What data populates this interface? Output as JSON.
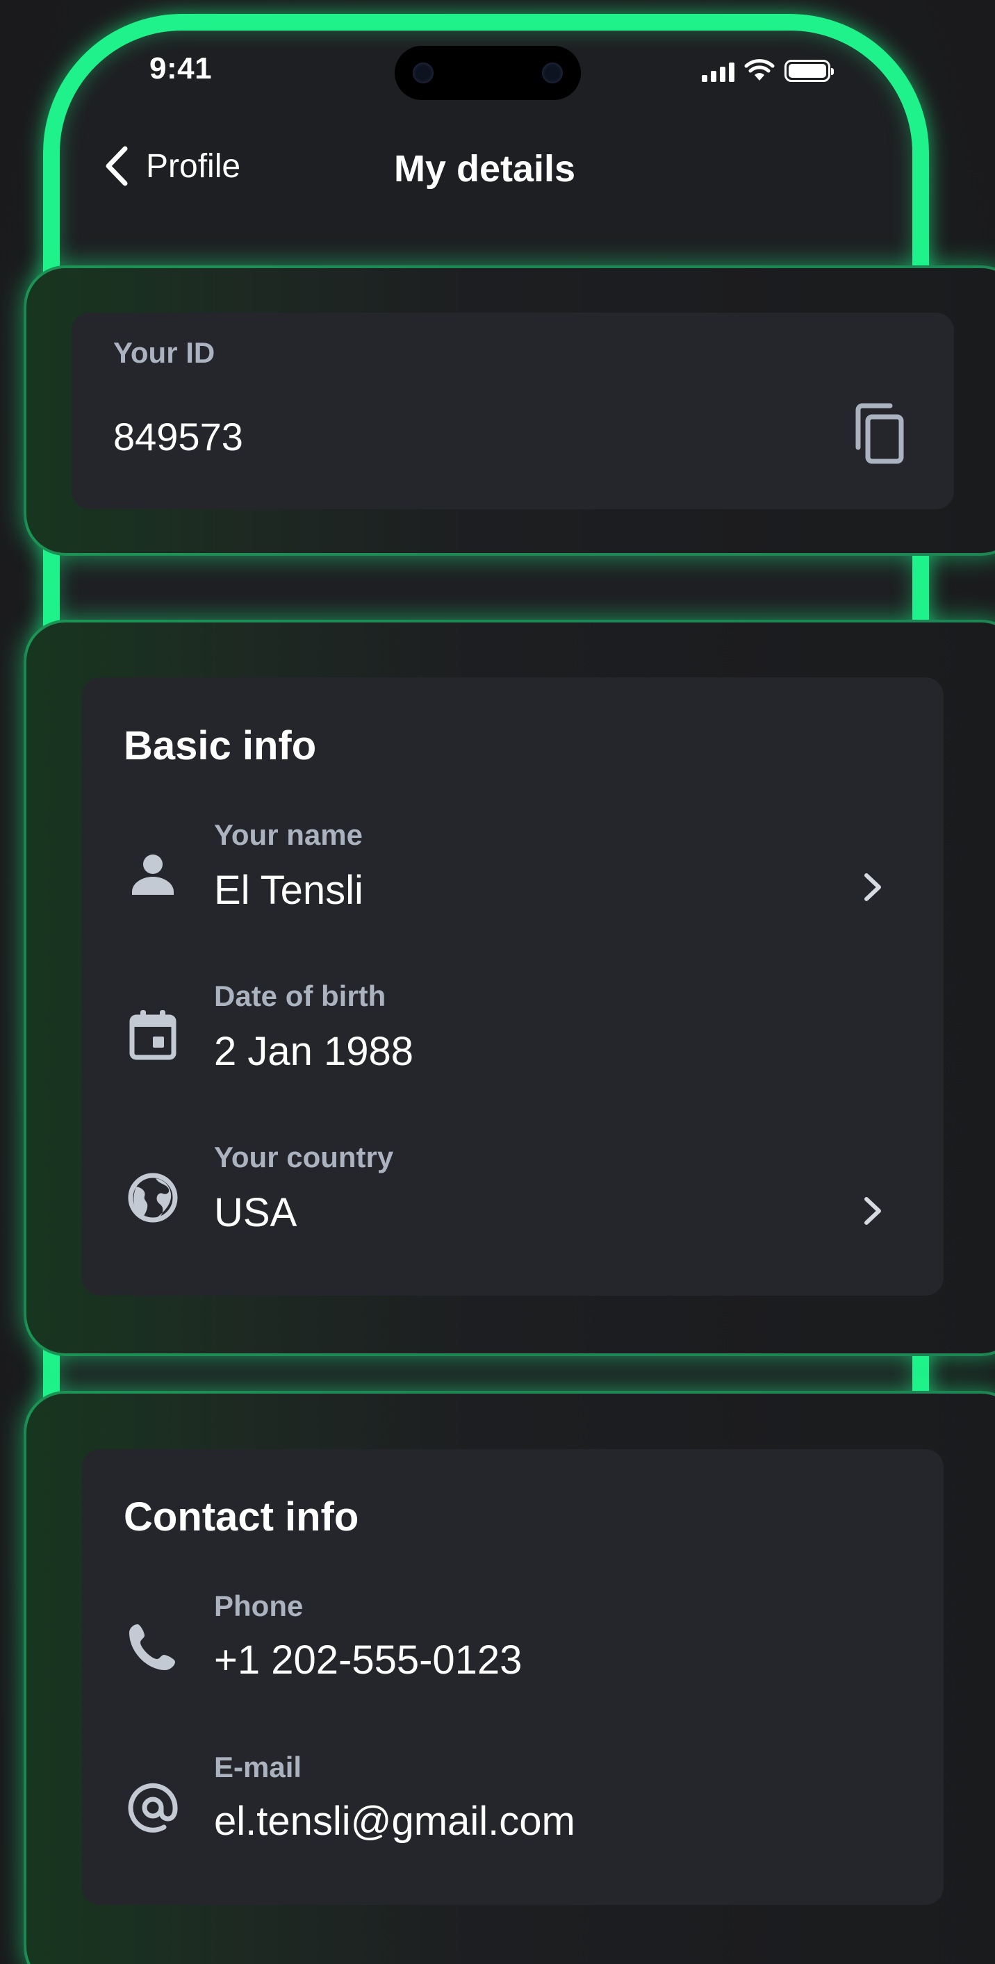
{
  "status_bar": {
    "time": "9:41"
  },
  "nav": {
    "back_label": "Profile",
    "title": "My details"
  },
  "id_card": {
    "label": "Your ID",
    "value": "849573"
  },
  "basic_info": {
    "title": "Basic info",
    "rows": [
      {
        "label": "Your name",
        "value": "El Tensli",
        "icon": "person-icon",
        "has_chevron": true
      },
      {
        "label": "Date of birth",
        "value": "2 Jan 1988",
        "icon": "calendar-icon",
        "has_chevron": false
      },
      {
        "label": "Your country",
        "value": "USA",
        "icon": "globe-icon",
        "has_chevron": true
      }
    ]
  },
  "contact_info": {
    "title": "Contact info",
    "rows": [
      {
        "label": "Phone",
        "value": "+1 202-555-0123",
        "icon": "phone-icon"
      },
      {
        "label": "E-mail",
        "value": "el.tensli@gmail.com",
        "icon": "at-sign-icon"
      }
    ]
  },
  "colors": {
    "accent_glow": "#1ff28a",
    "card_bg": "#25262b",
    "label_gray": "#aab3bf",
    "screen_bg": "#1e1f22"
  }
}
